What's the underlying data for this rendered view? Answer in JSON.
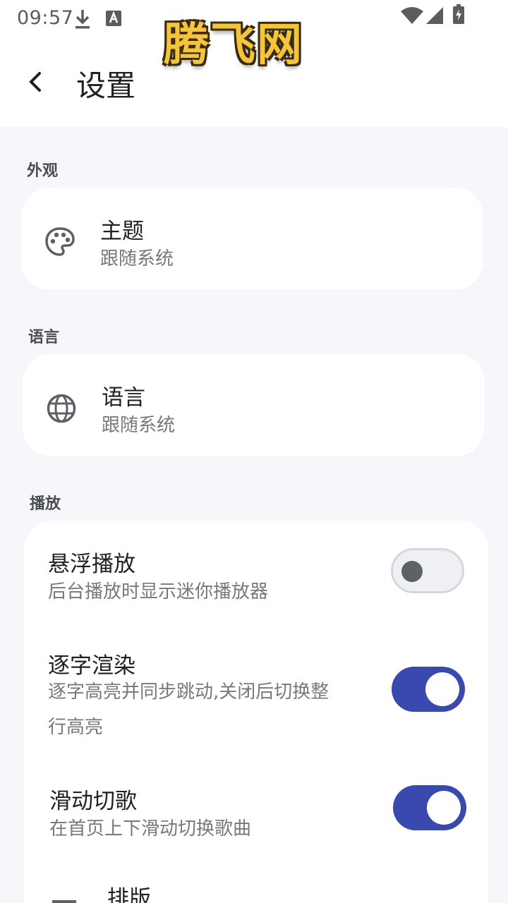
{
  "status_bar": {
    "time": "09:57",
    "icons": [
      "download-icon",
      "keyboard-a-icon",
      "wifi-icon",
      "signal-icon",
      "battery-charging-icon"
    ]
  },
  "watermark": {
    "text": "腾飞网"
  },
  "header": {
    "title": "设置",
    "back_icon": "chevron-left-icon"
  },
  "sections": {
    "appearance": {
      "label": "外观",
      "theme": {
        "title": "主题",
        "subtitle": "跟随系统",
        "icon": "palette-icon"
      }
    },
    "language": {
      "label": "语言",
      "language": {
        "title": "语言",
        "subtitle": "跟随系统",
        "icon": "globe-icon"
      }
    },
    "playback": {
      "label": "播放",
      "floating": {
        "title": "悬浮播放",
        "subtitle": "后台播放时显示迷你播放器",
        "on": false
      },
      "word_render": {
        "title": "逐字渲染",
        "subtitle_line1": "逐字高亮并同步跳动,关闭后切换整",
        "subtitle_line2": "行高亮",
        "on": true
      },
      "swipe": {
        "title": "滑动切歌",
        "subtitle": "在首页上下滑动切换歌曲",
        "on": true
      },
      "layout": {
        "title": "排版",
        "icon": "layout-icon"
      }
    }
  },
  "colors": {
    "accent": "#3a49ad",
    "background": "#f6f7fa",
    "card": "#ffffff",
    "watermark_fill": "#f4c53a"
  }
}
